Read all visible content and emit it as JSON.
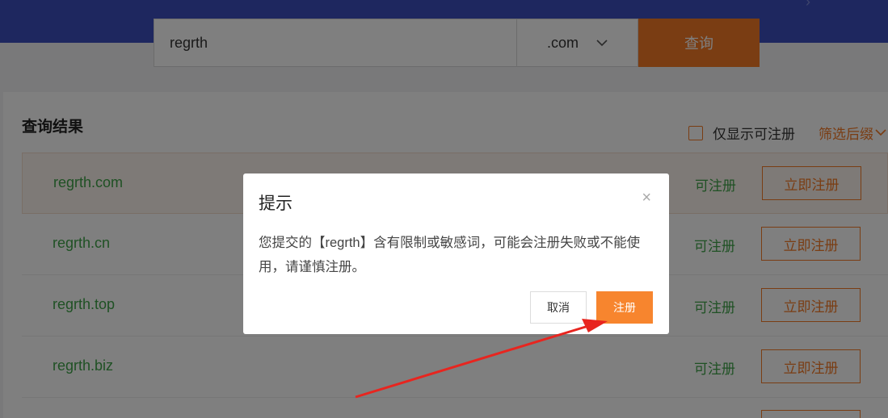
{
  "search": {
    "query": "regrth",
    "tld": ".com",
    "button_label": "查询"
  },
  "results": {
    "title": "查询结果",
    "filter_only_available": "仅显示可注册",
    "filter_suffix": "筛选后缀",
    "rows": [
      {
        "domain": "regrth.com",
        "status": "可注册",
        "action": "立即注册"
      },
      {
        "domain": "regrth.cn",
        "status": "可注册",
        "action": "立即注册"
      },
      {
        "domain": "regrth.top",
        "status": "可注册",
        "action": "立即注册"
      },
      {
        "domain": "regrth.biz",
        "status": "可注册",
        "action": "立即注册"
      }
    ]
  },
  "dialog": {
    "title": "提示",
    "close": "×",
    "message": "您提交的【regrth】含有限制或敏感词，可能会注册失败或不能使用，请谨慎注册。",
    "cancel_label": "取消",
    "confirm_label": "注册"
  },
  "icons": {
    "tld_dropdown": "chevron-down-icon",
    "filter_dropdown": "chevron-down-icon",
    "close": "close-icon"
  },
  "colors": {
    "brand": "#3d4fbf",
    "accent": "#f47a27",
    "available": "#3ea348",
    "arrow": "#e8251f"
  }
}
